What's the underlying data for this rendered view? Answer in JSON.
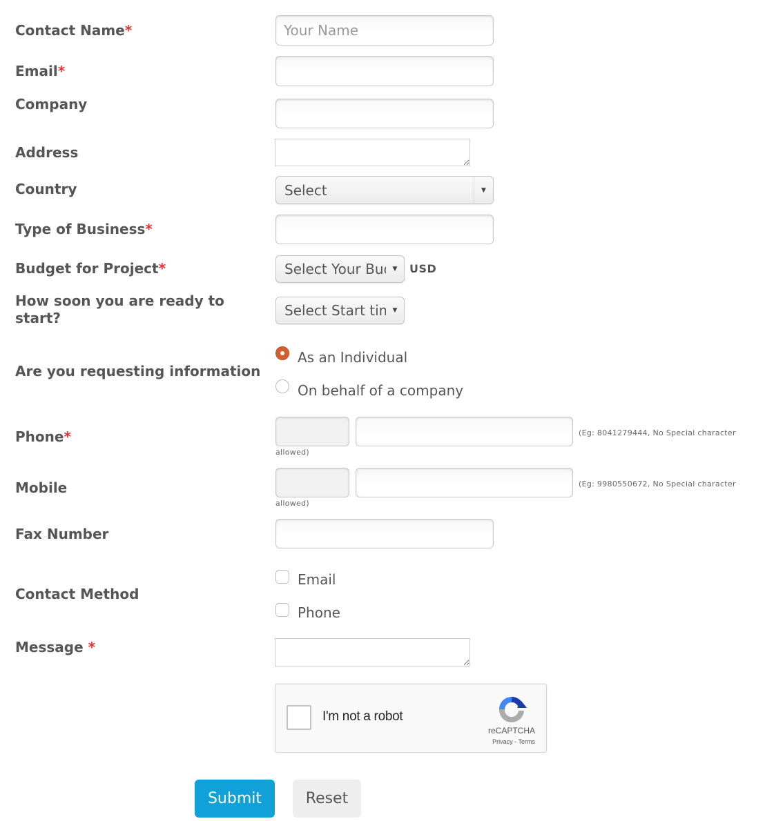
{
  "form": {
    "contact_name": {
      "label": "Contact Name",
      "required": "*",
      "placeholder": "Your Name",
      "value": ""
    },
    "email": {
      "label": "Email",
      "required": "*",
      "value": ""
    },
    "company": {
      "label": "Company",
      "value": ""
    },
    "address": {
      "label": "Address",
      "value": ""
    },
    "country": {
      "label": "Country",
      "selected": "Select"
    },
    "type_of_business": {
      "label": "Type of Business",
      "required": "*",
      "value": ""
    },
    "budget": {
      "label": "Budget for Project",
      "required": "*",
      "selected": "Select Your Budget",
      "currency": "USD"
    },
    "start_time": {
      "label_line1": "How soon you are ready to",
      "label_line2": "start?",
      "selected": "Select Start time"
    },
    "requesting": {
      "label": "Are you requesting information",
      "options": [
        {
          "label": "As an Individual",
          "checked": true
        },
        {
          "label": "On behalf of a company",
          "checked": false
        }
      ]
    },
    "phone": {
      "label": "Phone",
      "required": "*",
      "code": "",
      "number": "",
      "hint": "(Eg: 8041279444, No Special character",
      "hint_cont": "allowed)"
    },
    "mobile": {
      "label": "Mobile",
      "code": "",
      "number": "",
      "hint": "(Eg: 9980550672, No Special character",
      "hint_cont": "allowed)"
    },
    "fax": {
      "label": "Fax Number",
      "value": ""
    },
    "contact_method": {
      "label": "Contact Method",
      "options": [
        {
          "label": "Email",
          "checked": false
        },
        {
          "label": "Phone",
          "checked": false
        }
      ]
    },
    "message": {
      "label": "Message",
      "required": "*",
      "value": ""
    }
  },
  "captcha": {
    "label": "I'm not a robot",
    "brand": "reCAPTCHA",
    "links": "Privacy - Terms",
    "icon": "recaptcha-icon"
  },
  "buttons": {
    "submit": "Submit",
    "reset": "Reset"
  },
  "colors": {
    "accent": "#0fa1d8",
    "required": "#e8312f",
    "radio_selected": "#d2612f"
  }
}
